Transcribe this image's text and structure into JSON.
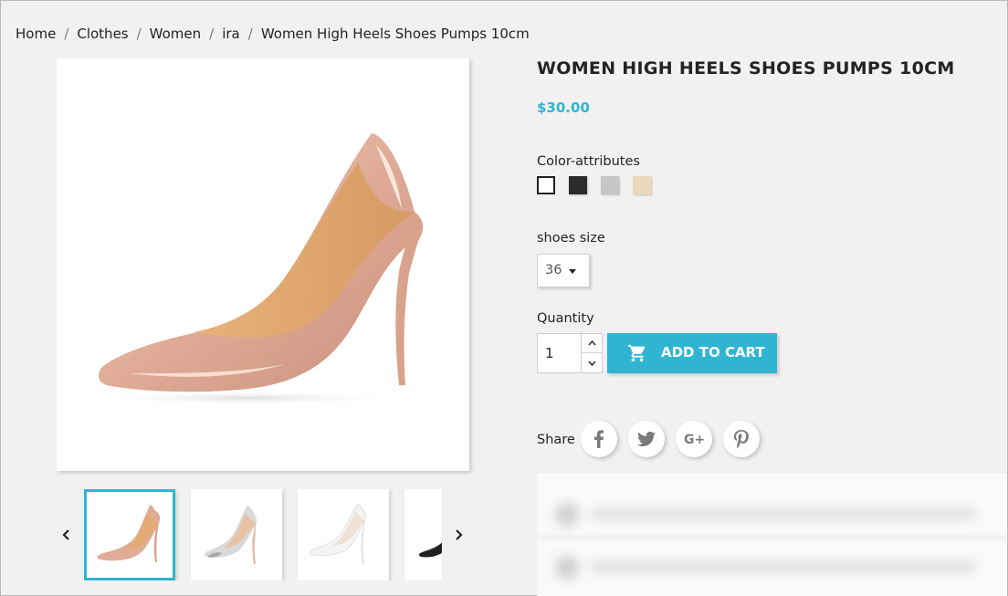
{
  "breadcrumb": {
    "items": [
      "Home",
      "Clothes",
      "Women",
      "ira",
      "Women High Heels Shoes Pumps 10cm"
    ],
    "separator": "/"
  },
  "product": {
    "title": "WOMEN HIGH HEELS SHOES PUMPS 10CM",
    "price": "$30.00",
    "accent_color": "#2fb5d2"
  },
  "color_attributes": {
    "label": "Color-attributes",
    "swatches": [
      {
        "name": "white",
        "color": "#ffffff",
        "selected": true
      },
      {
        "name": "black",
        "color": "#2b2b2b",
        "selected": false
      },
      {
        "name": "grey",
        "color": "#c6c6c6",
        "selected": false
      },
      {
        "name": "beige",
        "color": "#ecd9b9",
        "selected": false
      }
    ]
  },
  "shoes_size": {
    "label": "shoes size",
    "selected": "36"
  },
  "quantity": {
    "label": "Quantity",
    "value": "1"
  },
  "add_to_cart": {
    "label": "ADD TO CART",
    "icon": "cart-icon"
  },
  "share": {
    "label": "Share",
    "networks": [
      "facebook-icon",
      "twitter-icon",
      "google-plus-icon",
      "pinterest-icon"
    ]
  },
  "thumbnails": {
    "items": [
      "nude pump",
      "silver pump",
      "white pump",
      "black pump"
    ],
    "selected_index": 0,
    "prev_icon": "chevron-left-icon",
    "next_icon": "chevron-right-icon"
  }
}
